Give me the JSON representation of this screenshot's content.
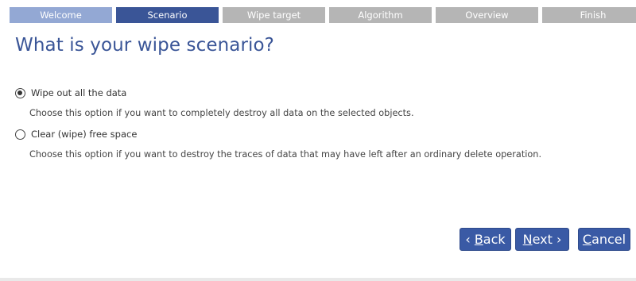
{
  "steps": [
    {
      "label": "Welcome",
      "state": "done"
    },
    {
      "label": "Scenario",
      "state": "active"
    },
    {
      "label": "Wipe target",
      "state": "todo"
    },
    {
      "label": "Algorithm",
      "state": "todo"
    },
    {
      "label": "Overview",
      "state": "todo"
    },
    {
      "label": "Finish",
      "state": "todo"
    }
  ],
  "title": "What is your wipe scenario?",
  "options": [
    {
      "label": "Wipe out all the data",
      "checked": true,
      "description": "Choose this option if you want to completely destroy all data on the selected objects."
    },
    {
      "label": "Clear (wipe) free space",
      "checked": false,
      "description": "Choose this option if you want to destroy the traces of data that may have left after an ordinary delete operation."
    }
  ],
  "buttons": {
    "back": {
      "prefix": "‹ ",
      "mnemonic": "B",
      "rest": "ack"
    },
    "next": {
      "mnemonic": "N",
      "rest": "ext ›"
    },
    "cancel": {
      "mnemonic": "C",
      "rest": "ancel"
    }
  },
  "colors": {
    "accent": "#3a5597",
    "step_done": "#93a8d4",
    "step_todo": "#b5b5b5",
    "button": "#3a5aa5"
  }
}
